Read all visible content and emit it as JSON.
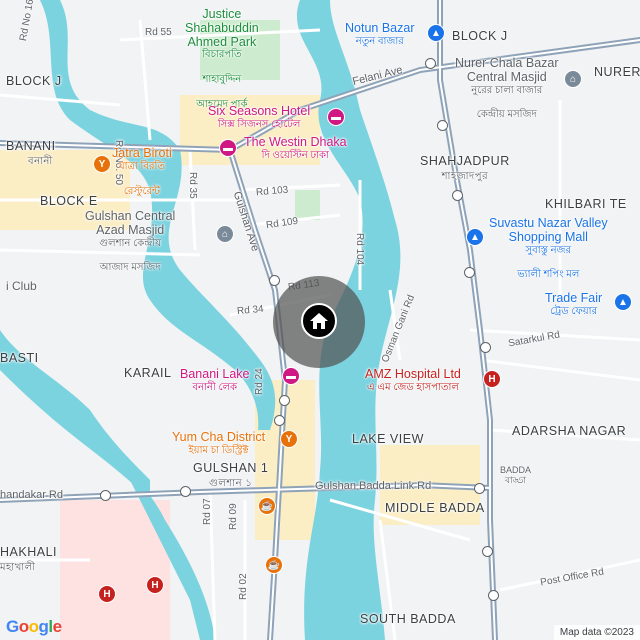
{
  "map": {
    "areas": {
      "block_j_left": "BLOCK J",
      "block_j_right": "BLOCK J",
      "banani": "BANANI",
      "banani_bn": "বনানী",
      "block_e": "BLOCK E",
      "nurer": "NURER",
      "shahjadpur": "SHAHJADPUR",
      "shahjadpur_bn": "শাহজাদপুর",
      "khilbari": "KHILBARI TE",
      "karail": "KARAIL",
      "basti": "BASTI",
      "lake_view": "LAKE VIEW",
      "adarsha_nagar": "ADARSHA NAGAR",
      "gulshan1": "GULSHAN 1",
      "gulshan1_bn": "গুলশান ১",
      "middle_badda": "MIDDLE BADDA",
      "badda": "BADDA",
      "badda_bn": "বাড্ডা",
      "khakhali": "HAKHALI",
      "khakhali_bn": "মহাখালী",
      "south_badda": "SOUTH BADDA",
      "club": "i Club"
    },
    "roads": {
      "rd16": "Rd No 16",
      "rd55": "Rd 55",
      "rd50": "Rd No. 50",
      "rd35": "Rd 35",
      "rd103": "Rd 103",
      "rd109": "Rd 109",
      "rd104": "Rd 104",
      "rd113": "Rd 113",
      "rd34": "Rd 34",
      "rd24": "Rd 24",
      "rd07": "Rd 07",
      "rd09": "Rd 09",
      "rd02": "Rd 02",
      "gulshan_ave": "Gulshan Ave",
      "felani_ave": "Felani Ave",
      "osman_gani": "Osman Gani Rd",
      "satarkul": "Satarkul Rd",
      "gulshan_badda_link": "Gulshan Badda Link Rd",
      "kandakar": "handakar Rd",
      "post_office": "Post Office Rd"
    },
    "pois": {
      "justice_park": "Justice",
      "justice_park2": "Shahabuddin",
      "justice_park3": "Ahmed Park",
      "justice_park_bn1": "বিচারপতি",
      "justice_park_bn2": "শাহাবুদ্দিন",
      "justice_park_bn3": "আহমেদ পার্ক",
      "notun_bazar": "Notun Bazar",
      "notun_bazar_bn": "নতুন বাজার",
      "nurer_chala1": "Nurer Chala Bazar",
      "nurer_chala2": "Central Masjid",
      "nurer_chala_bn1": "নুরের চালা বাজার",
      "nurer_chala_bn2": "কেন্দ্রীয় মসজিদ",
      "six_seasons": "Six Seasons Hotel",
      "six_seasons_bn": "সিক্স সিজনস হোটেল",
      "westin": "The Westin Dhaka",
      "westin_bn": "দি ওয়েস্টিন ঢাকা",
      "jatra1": "Jatra Biroti",
      "jatra_bn1": "যাত্রা বিরতি",
      "jatra_bn2": "রেস্টুরেন্ট",
      "gcam1": "Gulshan Central",
      "gcam2": "Azad Masjid",
      "gcam_bn1": "গুলশান কেন্দ্রীয়",
      "gcam_bn2": "আজাদ মসজিদ",
      "suvastu1": "Suvastu Nazar Valley",
      "suvastu2": "Shopping Mall",
      "suvastu_bn1": "সুবাস্তু নজর",
      "suvastu_bn2": "ভ্যালী শপিং মল",
      "trade_fair": "Trade Fair",
      "trade_fair_bn": "ট্রেড ফেয়ার",
      "banani_lake": "Banani Lake",
      "banani_lake_bn": "বনানী লেক",
      "amz": "AMZ Hospital Ltd",
      "amz_bn": "এ এম জেড হাসপাতাল",
      "yumcha": "Yum Cha District",
      "yumcha_bn": "ইয়াম চা ডিস্ট্রিক্ট"
    },
    "footer": {
      "logo": "Google",
      "attribution": "Map data ©2023"
    },
    "marker": {
      "icon": "home-icon"
    },
    "colors": {
      "water": "#7cd3e0",
      "land": "#f1f3f4",
      "park": "#cdeccf",
      "highway": "#8fa3b8",
      "urban": "#fbeec5",
      "hospital_area": "#fde2e1"
    }
  }
}
